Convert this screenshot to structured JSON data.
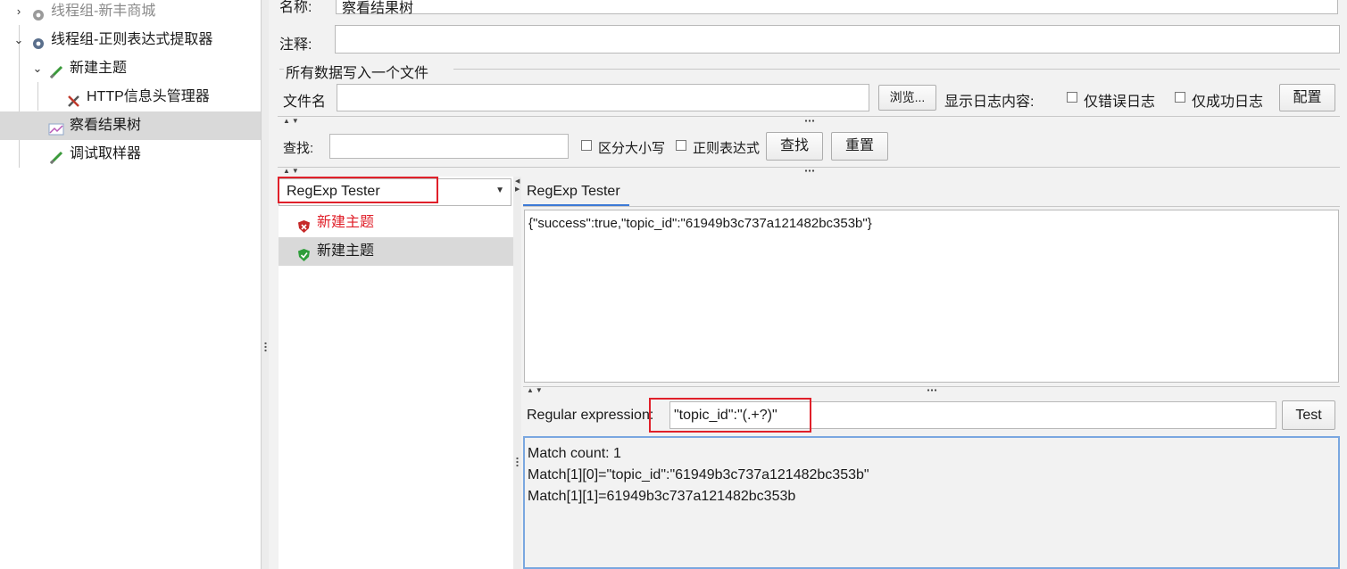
{
  "tree": {
    "items": [
      {
        "label": "线程组-新丰商城",
        "disabled": true
      },
      {
        "label": "线程组-正则表达式提取器"
      },
      {
        "label": "新建主题"
      },
      {
        "label": "HTTP信息头管理器"
      },
      {
        "label": "察看结果树",
        "selected": true
      },
      {
        "label": "调试取样器"
      }
    ]
  },
  "form": {
    "name_label": "名称:",
    "name_value": "察看结果树",
    "comment_label": "注释:",
    "comment_value": "",
    "file_group_title": "所有数据写入一个文件",
    "filename_label": "文件名",
    "filename_value": "",
    "browse_label": "浏览...",
    "log_label": "显示日志内容:",
    "errors_only_label": "仅错误日志",
    "success_only_label": "仅成功日志",
    "configure_label": "配置"
  },
  "search": {
    "label": "查找:",
    "value": "",
    "case_label": "区分大小写",
    "regex_label": "正则表达式",
    "find_label": "查找",
    "reset_label": "重置"
  },
  "results": {
    "renderer_selected": "RegExp Tester",
    "samples": [
      {
        "label": "新建主题",
        "status": "error"
      },
      {
        "label": "新建主题",
        "status": "success",
        "selected": true
      }
    ]
  },
  "tester": {
    "tab_label": "RegExp Tester",
    "response_text": "{\"success\":true,\"topic_id\":\"61949b3c737a121482bc353b\"}",
    "regex_label": "Regular expression:",
    "regex_value": "\"topic_id\":\"(.+?)\"",
    "test_label": "Test",
    "output_lines": [
      "Match count: 1",
      "Match[1][0]=\"topic_id\":\"61949b3c737a121482bc353b\"",
      "Match[1][1]=61949b3c737a121482bc353b"
    ]
  },
  "colors": {
    "error_text": "#e0202a",
    "highlight_box": "#e0202a",
    "tab_underline": "#3c7ad6",
    "selection": "#d9d9d9"
  }
}
